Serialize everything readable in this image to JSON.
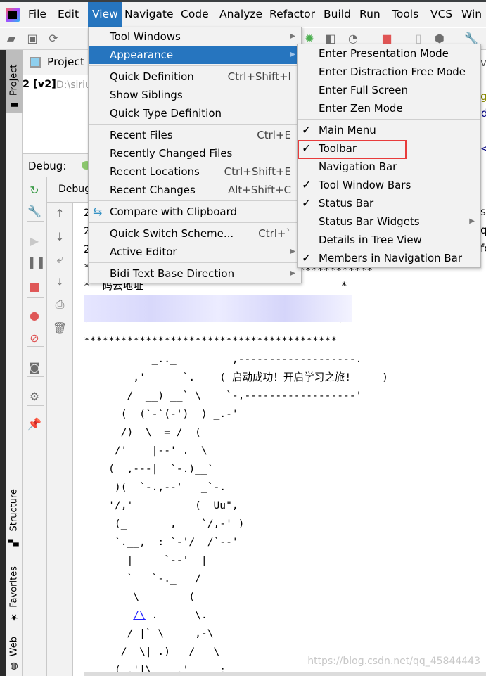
{
  "menubar": {
    "items": [
      "File",
      "Edit",
      "View",
      "Navigate",
      "Code",
      "Analyze",
      "Refactor",
      "Build",
      "Run",
      "Tools",
      "VCS",
      "Win"
    ],
    "active": "View"
  },
  "left_stripe": {
    "project": "Project",
    "structure": "Structure",
    "favorites": "Favorites",
    "web": "Web"
  },
  "project_panel": {
    "title": "Project",
    "tree_item_bold": "2 [v2]",
    "tree_item_path": "D:\\siriu"
  },
  "debug": {
    "header": "Debug:",
    "tab": "Debug"
  },
  "view_menu": {
    "items": [
      {
        "label": "Tool Windows",
        "submenu": true
      },
      {
        "label": "Appearance",
        "submenu": true,
        "selected": true
      },
      {
        "sep": true
      },
      {
        "label": "Quick Definition",
        "shortcut": "Ctrl+Shift+I"
      },
      {
        "label": "Show Siblings"
      },
      {
        "label": "Quick Type Definition"
      },
      {
        "sep": true
      },
      {
        "label": "Recent Files",
        "shortcut": "Ctrl+E"
      },
      {
        "label": "Recently Changed Files"
      },
      {
        "label": "Recent Locations",
        "shortcut": "Ctrl+Shift+E"
      },
      {
        "label": "Recent Changes",
        "shortcut": "Alt+Shift+C"
      },
      {
        "sep": true
      },
      {
        "label": "Compare with Clipboard",
        "icon": "compare-clipboard-icon"
      },
      {
        "sep": true
      },
      {
        "label": "Quick Switch Scheme...",
        "shortcut": "Ctrl+`"
      },
      {
        "label": "Active Editor",
        "submenu": true
      },
      {
        "sep": true
      },
      {
        "label": "Bidi Text Base Direction",
        "submenu": true
      }
    ]
  },
  "appearance_menu": {
    "items": [
      {
        "label": "Enter Presentation Mode"
      },
      {
        "label": "Enter Distraction Free Mode"
      },
      {
        "label": "Enter Full Screen"
      },
      {
        "label": "Enter Zen Mode"
      },
      {
        "sep": true
      },
      {
        "label": "Main Menu",
        "checked": true
      },
      {
        "label": "Toolbar",
        "checked": true,
        "highlighted": true
      },
      {
        "label": "Navigation Bar"
      },
      {
        "label": "Tool Window Bars",
        "checked": true
      },
      {
        "label": "Status Bar",
        "checked": true
      },
      {
        "label": "Status Bar Widgets",
        "submenu": true
      },
      {
        "label": "Details in Tree View"
      },
      {
        "label": "Members in Navigation Bar",
        "checked": true
      }
    ]
  },
  "console": {
    "lines_top": [
      "2",
      "2",
      "2",
      "*",
      "*  码云地址                                *",
      "",
      "*                                        *",
      "*****************************************"
    ],
    "art": [
      "           _.._         ,-------------------.",
      "        ,'      `.    ( 启动成功！开启学习之旅!     )",
      "       /  __) __` \\    `-,------------------'",
      "      (  (`-`(-')  ) _.-'",
      "      /)  \\  = /  (",
      "     /'    |--' .  \\",
      "    (  ,---|  `-.)__`",
      "     )(  `-.,--'   _`-.",
      "    '/,'          (  Uu\",",
      "     (_       ,    `/,-' )",
      "     `.__,  : `-'/  /`--'",
      "       |     `--'  |",
      "       `   `-._   /",
      "        \\        (",
      "",
      "       / |` \\     ,-\\",
      "      /  \\| .)   /   \\",
      "     ( ,'|\\    ,'     :"
    ],
    "link_line": {
      "prefix": "        ",
      "link": "/\\",
      "rest": " .      \\."
    },
    "right_fragments": [
      "va",
      "gl",
      "d",
      "<",
      "se",
      "qu",
      "fo"
    ],
    "top_stars_tail": "*************"
  },
  "watermark": "https://blog.csdn.net/qq_45844443",
  "colors": {
    "accent": "#2675bf",
    "highlight_box": "#e83b3b",
    "link": "#2020ff"
  }
}
